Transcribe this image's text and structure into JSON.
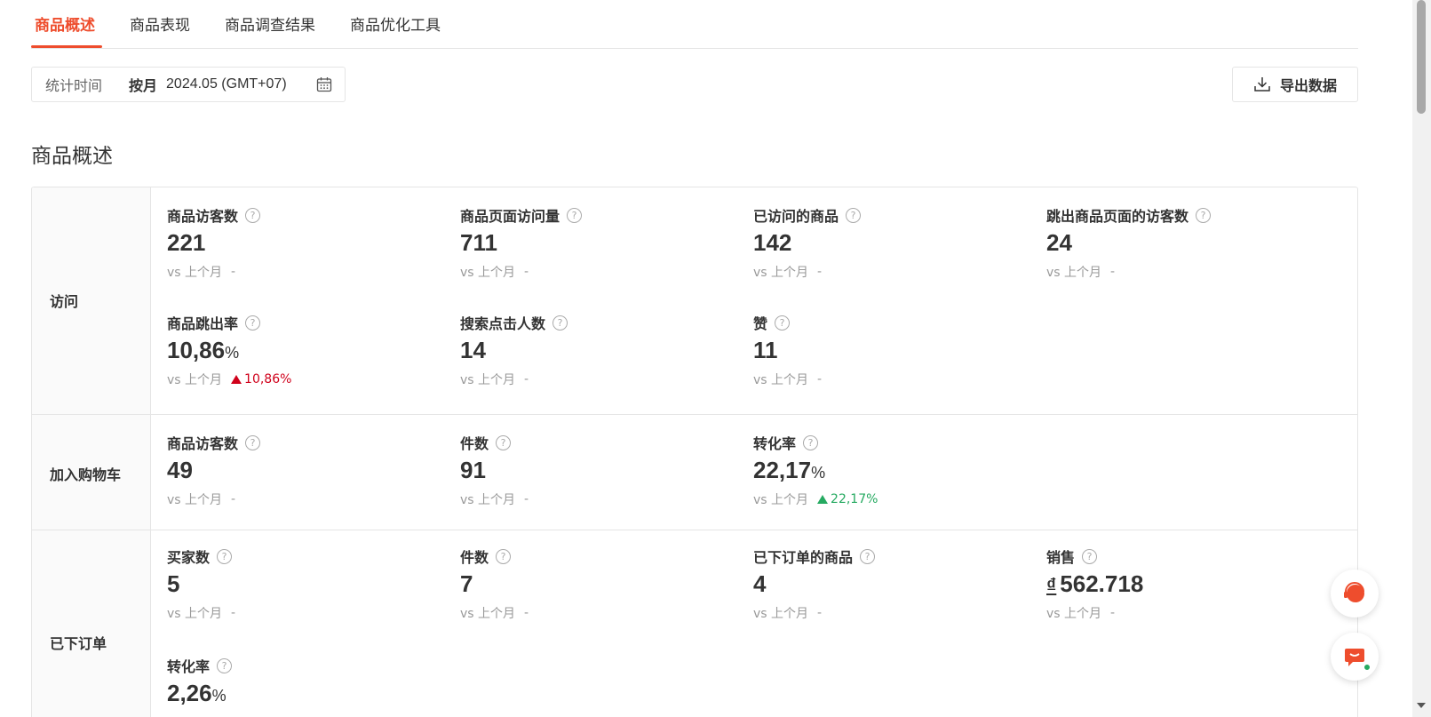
{
  "tabs": [
    {
      "label": "商品概述",
      "active": true
    },
    {
      "label": "商品表现",
      "active": false
    },
    {
      "label": "商品调查结果",
      "active": false
    },
    {
      "label": "商品优化工具",
      "active": false
    }
  ],
  "filter": {
    "label": "统计时间",
    "mode": "按月",
    "date": "2024.05 (GMT+07)"
  },
  "export_label": "导出数据",
  "section_title": "商品概述",
  "compare_label": "vs 上个月",
  "dash": "-",
  "groups": {
    "visit": {
      "label": "访问",
      "metrics": [
        {
          "title": "商品访客数",
          "value": "221",
          "change": "-"
        },
        {
          "title": "商品页面访问量",
          "value": "711",
          "change": "-"
        },
        {
          "title": "已访问的商品",
          "value": "142",
          "change": "-"
        },
        {
          "title": "跳出商品页面的访客数",
          "value": "24",
          "change": "-"
        },
        {
          "title": "商品跳出率",
          "value": "10,86",
          "unit": "%",
          "change": "10,86%",
          "trend": "up-red"
        },
        {
          "title": "搜索点击人数",
          "value": "14",
          "change": "-"
        },
        {
          "title": "赞",
          "value": "11",
          "change": "-"
        }
      ]
    },
    "cart": {
      "label": "加入购物车",
      "metrics": [
        {
          "title": "商品访客数",
          "value": "49",
          "change": "-"
        },
        {
          "title": "件数",
          "value": "91",
          "change": "-"
        },
        {
          "title": "转化率",
          "value": "22,17",
          "unit": "%",
          "change": "22,17%",
          "trend": "up-green"
        }
      ]
    },
    "order": {
      "label": "已下订单",
      "metrics": [
        {
          "title": "买家数",
          "value": "5",
          "change": "-"
        },
        {
          "title": "件数",
          "value": "7",
          "change": "-"
        },
        {
          "title": "已下订单的商品",
          "value": "4",
          "change": "-"
        },
        {
          "title": "销售",
          "currency": "₫",
          "value": "562.718",
          "change": "-"
        },
        {
          "title": "转化率",
          "value": "2,26",
          "unit": "%"
        }
      ]
    }
  },
  "colors": {
    "accent": "#ee4d2d",
    "up_red": "#d0011b",
    "up_green": "#26aa61"
  },
  "icons": {
    "calendar": "calendar-icon",
    "download": "download-icon",
    "help": "help-circle-icon",
    "support": "customer-service-icon",
    "chat": "chat-icon"
  }
}
